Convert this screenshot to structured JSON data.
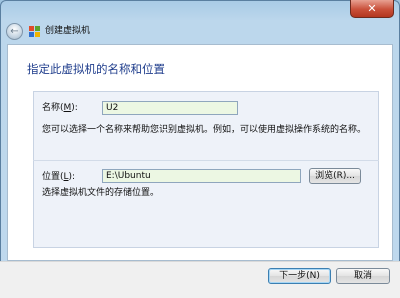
{
  "window": {
    "title": "创建虚拟机",
    "back_label": "←",
    "close_label": "✕"
  },
  "page": {
    "heading": "指定此虚拟机的名称和位置"
  },
  "name_section": {
    "label_prefix": "名称(",
    "label_key": "M",
    "label_suffix": "):",
    "value": "U2",
    "help": "您可以选择一个名称来帮助您识别虚拟机。例如，可以使用虚拟操作系统的名称。"
  },
  "location_section": {
    "label_prefix": "位置(",
    "label_key": "L",
    "label_suffix": "):",
    "value": "E:\\Ubuntu",
    "browse_label": "浏览(R)...",
    "help": "选择虚拟机文件的存储位置。"
  },
  "footer": {
    "next_label": "下一步(N)",
    "cancel_label": "取消"
  },
  "colors": {
    "heading": "#1f3d8c",
    "input_bg": "#ecf7e3",
    "close_button": "#c9503a"
  }
}
